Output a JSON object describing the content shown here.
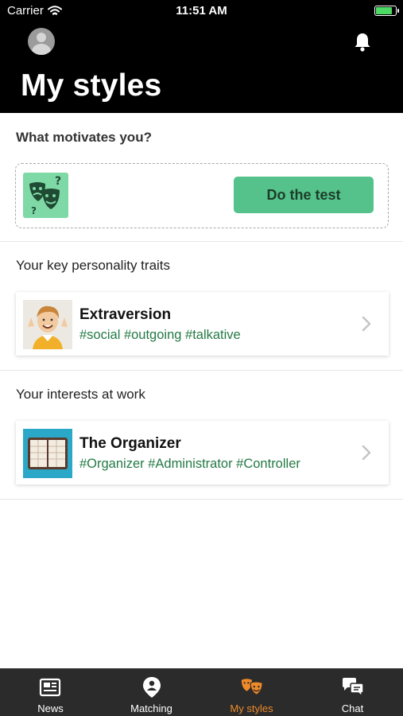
{
  "status_bar": {
    "carrier": "Carrier",
    "time": "11:51 AM"
  },
  "header": {
    "title": "My styles"
  },
  "motivation": {
    "heading": "What motivates you?",
    "button_label": "Do the test"
  },
  "traits": {
    "heading": "Your key personality traits",
    "card": {
      "title": "Extraversion",
      "tags": "#social #outgoing #talkative"
    }
  },
  "interests": {
    "heading": "Your interests at work",
    "card": {
      "title": "The Organizer",
      "tags": "#Organizer #Administrator #Controller"
    }
  },
  "tabs": [
    {
      "label": "News",
      "icon": "newspaper-icon",
      "active": false
    },
    {
      "label": "Matching",
      "icon": "person-pin-icon",
      "active": false
    },
    {
      "label": "My styles",
      "icon": "theater-masks-icon",
      "active": true
    },
    {
      "label": "Chat",
      "icon": "chat-bubbles-icon",
      "active": false
    }
  ],
  "colors": {
    "accent_green": "#54c28a",
    "tag_green": "#237a45",
    "active_tab": "#ef8a2a",
    "header_bg": "#000000",
    "tabbar_bg": "#2b2b2b"
  }
}
